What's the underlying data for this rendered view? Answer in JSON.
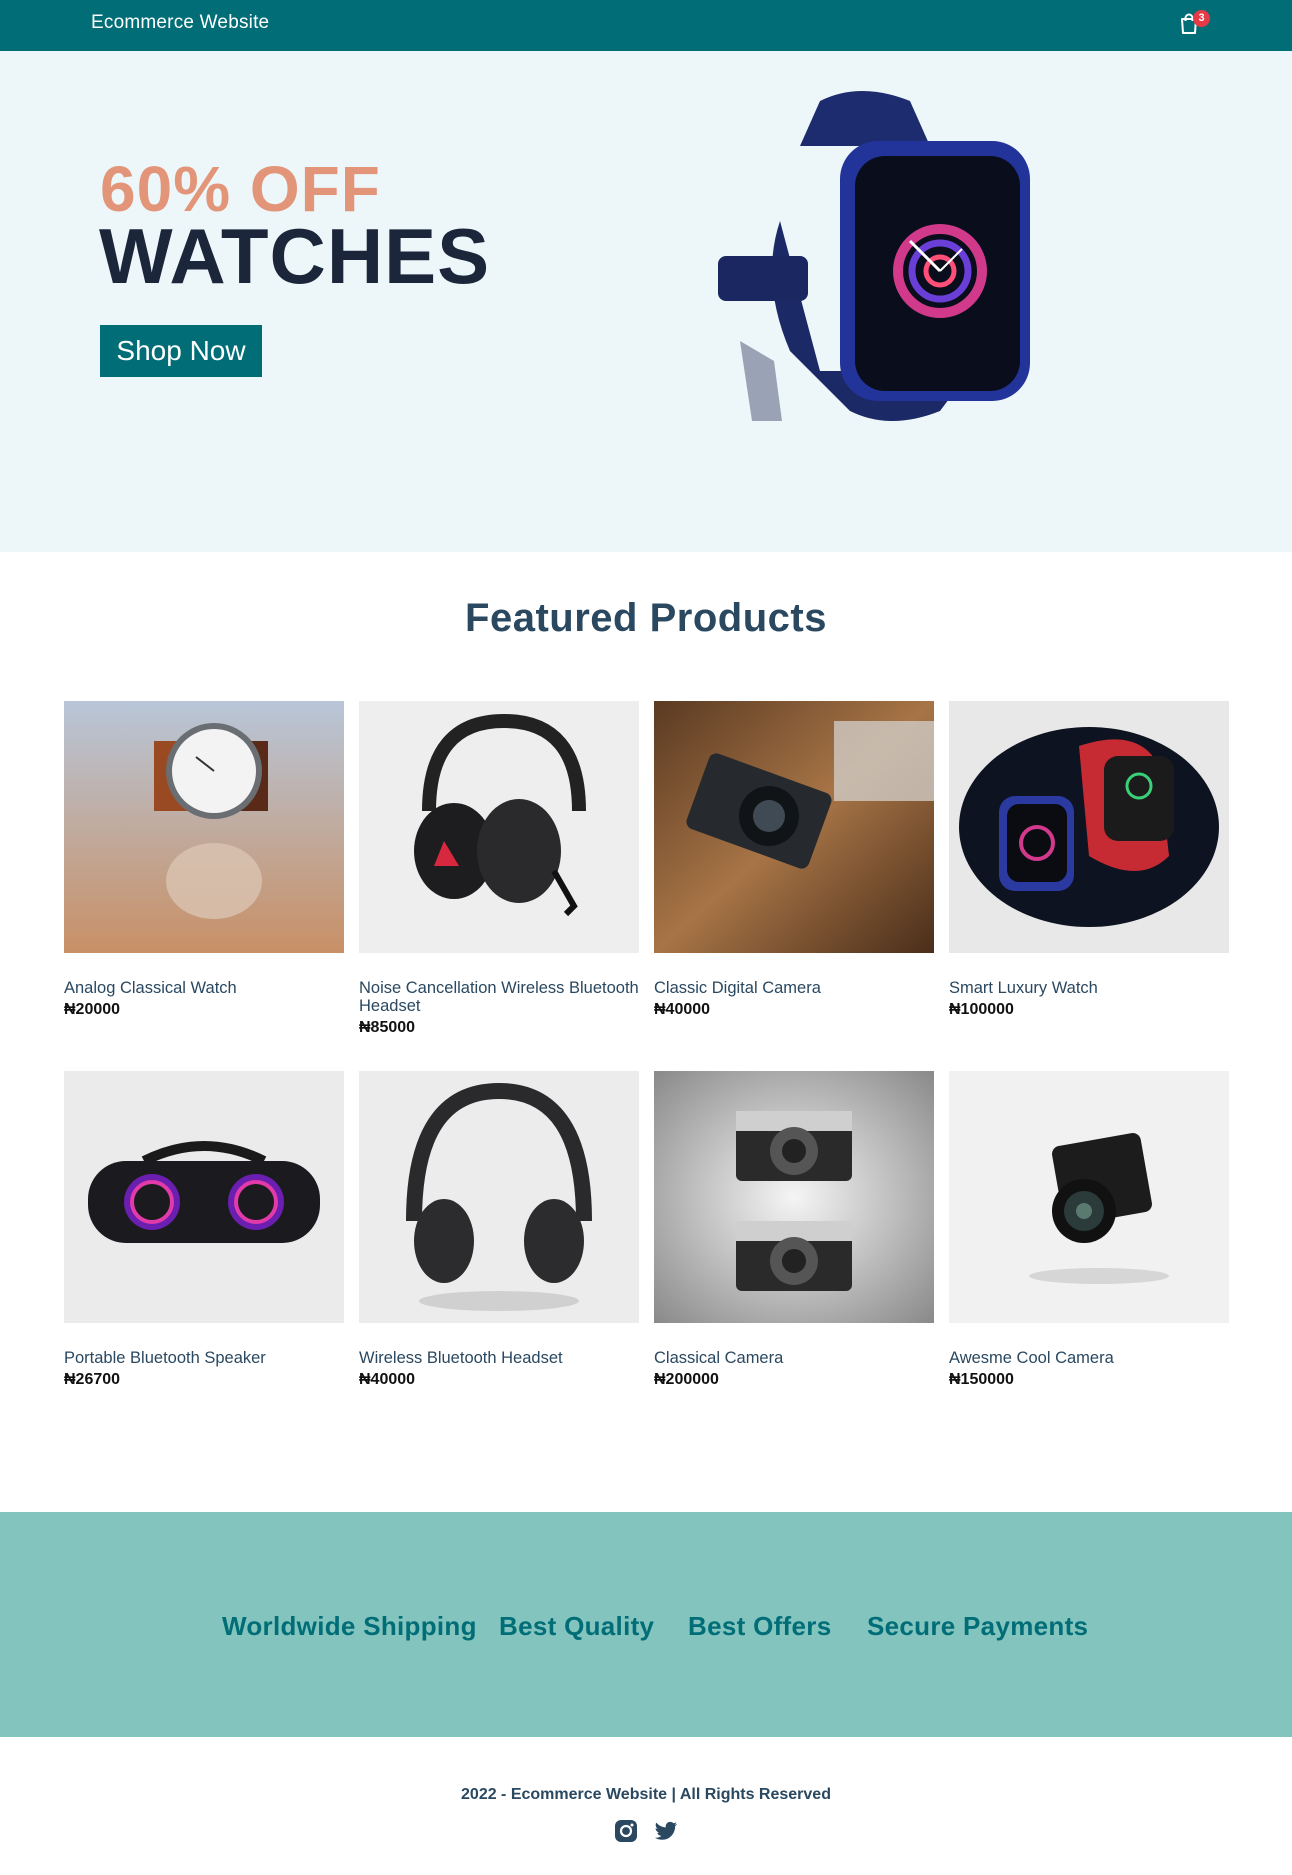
{
  "nav": {
    "brand": "Ecommerce Website",
    "cart_count": "3",
    "cart_icon": "shopping-bag-icon"
  },
  "hero": {
    "discount": "60% OFF",
    "title": "WATCHES",
    "button": "Shop Now"
  },
  "featured": {
    "title": "Featured Products",
    "products": [
      {
        "name": "Analog Classical Watch",
        "price": "₦20000"
      },
      {
        "name": "Noise Cancellation Wireless Bluetooth Headset",
        "price": "₦85000"
      },
      {
        "name": "Classic Digital Camera",
        "price": "₦40000"
      },
      {
        "name": "Smart Luxury Watch",
        "price": "₦100000"
      },
      {
        "name": "Portable Bluetooth Speaker",
        "price": "₦26700"
      },
      {
        "name": "Wireless Bluetooth Headset",
        "price": "₦40000"
      },
      {
        "name": "Classical Camera",
        "price": "₦200000"
      },
      {
        "name": "Awesme Cool Camera",
        "price": "₦150000"
      }
    ]
  },
  "features": [
    "Worldwide Shipping",
    "Best Quality",
    "Best Offers",
    "Secure Payments"
  ],
  "footer": {
    "copyright": "2022 - Ecommerce Website | All Rights Reserved",
    "icons": [
      "instagram-icon",
      "twitter-icon"
    ]
  },
  "colors": {
    "primary": "#006d77",
    "accent": "#e29578",
    "hero_bg": "#edf6f9",
    "band": "#83c5be",
    "badge": "#e63946"
  }
}
